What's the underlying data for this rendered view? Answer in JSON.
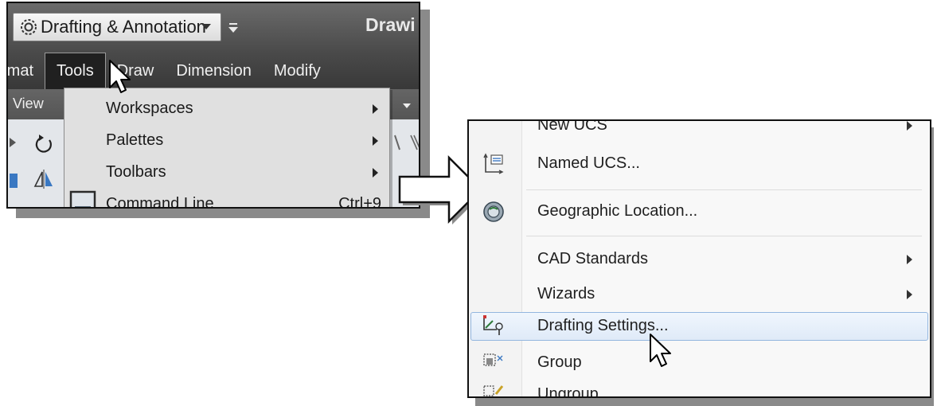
{
  "left_window": {
    "workspace_combo": {
      "value": "Drafting & Annotation",
      "icon": "gear-icon"
    },
    "title_fragment": "Drawi",
    "menubar": [
      "rmat",
      "Tools",
      "Draw",
      "Dimension",
      "Modify"
    ],
    "active_menu": "Tools",
    "ribbon_tab": "View",
    "tools_menu": {
      "items": [
        {
          "label": "Workspaces",
          "submenu": true
        },
        {
          "label": "Palettes",
          "submenu": true
        },
        {
          "label": "Toolbars",
          "submenu": true
        },
        {
          "label": "Command Line",
          "shortcut": "Ctrl+9",
          "icon": "command-line-icon"
        }
      ]
    }
  },
  "right_menu": {
    "items": [
      {
        "label": "New UCS",
        "submenu": true
      },
      {
        "label": "Named UCS...",
        "icon": "named-ucs-icon"
      },
      {
        "label": "Geographic Location...",
        "icon": "globe-icon"
      },
      {
        "label": "CAD Standards",
        "submenu": true
      },
      {
        "label": "Wizards",
        "submenu": true
      },
      {
        "label": "Drafting Settings...",
        "icon": "drafting-settings-icon",
        "highlighted": true
      },
      {
        "label": "Group",
        "icon": "group-icon"
      },
      {
        "label": "Ungroup",
        "icon": "ungroup-icon"
      }
    ]
  },
  "colors": {
    "menu_highlight_border": "#93b6df",
    "titlebar_dark": "#4a4a4a"
  }
}
